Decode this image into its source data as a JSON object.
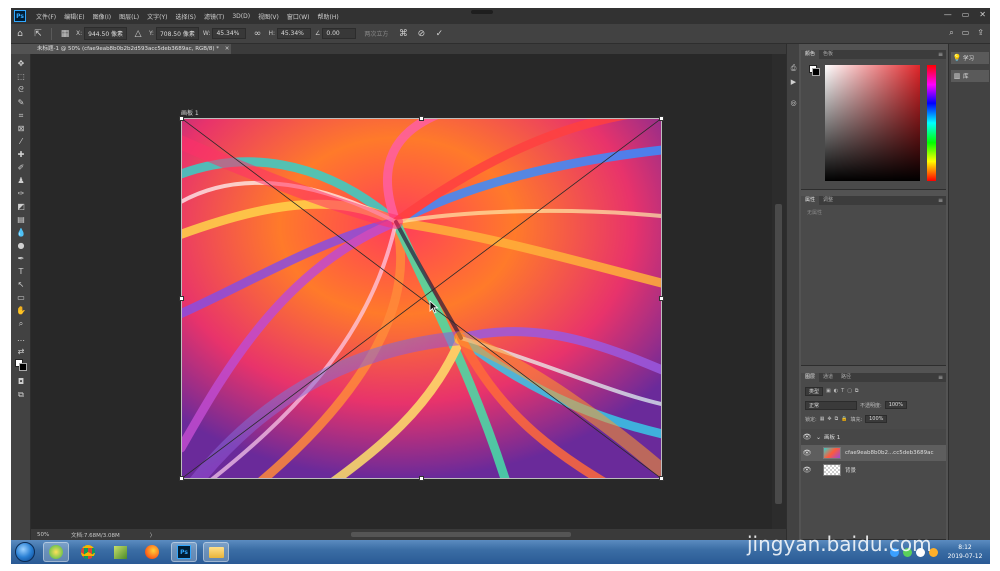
{
  "app": {
    "logo": "Ps",
    "menu": [
      "文件(F)",
      "编辑(E)",
      "图像(I)",
      "图层(L)",
      "文字(Y)",
      "选择(S)",
      "滤镜(T)",
      "3D(D)",
      "视图(V)",
      "窗口(W)",
      "帮助(H)"
    ],
    "window_controls": [
      "—",
      "▭",
      "✕"
    ]
  },
  "options_bar": {
    "x_label": "X:",
    "x_value": "944.50 像素",
    "y_label": "Y:",
    "y_value": "708.50 像素",
    "w_label": "W:",
    "w_value": "45.34%",
    "h_label": "H:",
    "h_value": "45.34%",
    "angle_value": "0.00",
    "interp_text": "两次立方",
    "right_icons": [
      "search-icon",
      "workspace-icon",
      "share-icon"
    ]
  },
  "document": {
    "tab_title": "未标题-1 @ 50% (cfae9eab8b0b2b2d593acc5deb3689ac, RGB/8) *",
    "tab_close": "✕",
    "artboard_label": "画板 1"
  },
  "status": {
    "zoom": "50%",
    "doc_info": "文档:7.68M/3.08M",
    "arrow": "〉"
  },
  "panels": {
    "color": {
      "tabs": [
        "颜色",
        "色板"
      ],
      "hue_color": "#e0262a"
    },
    "properties": {
      "tabs": [
        "属性",
        "调整"
      ],
      "note": "无属性"
    },
    "layers": {
      "tabs": [
        "图层",
        "通道",
        "路径"
      ],
      "kind_label": "类型",
      "blend_mode": "正常",
      "opacity_label": "不透明度:",
      "opacity_value": "100%",
      "lock_label": "锁定:",
      "fill_label": "填充:",
      "fill_value": "100%",
      "rows": [
        {
          "name": "画板 1"
        },
        {
          "name": "cfae9eab8b0b2...cc5deb3689ac"
        },
        {
          "name": "背景"
        }
      ]
    }
  },
  "learn_panel": {
    "items": [
      {
        "icon": "lightbulb-icon",
        "label": "学习"
      },
      {
        "icon": "library-icon",
        "label": "库"
      }
    ]
  },
  "taskbar": {
    "clock_time": "8:12",
    "clock_date": "2019-07-12",
    "apps": [
      "browser-360-icon",
      "chrome-icon",
      "3d-box-icon",
      "firefox-icon",
      "photoshop-icon",
      "folder-icon"
    ]
  },
  "watermark": "jingyan.baidu.com"
}
